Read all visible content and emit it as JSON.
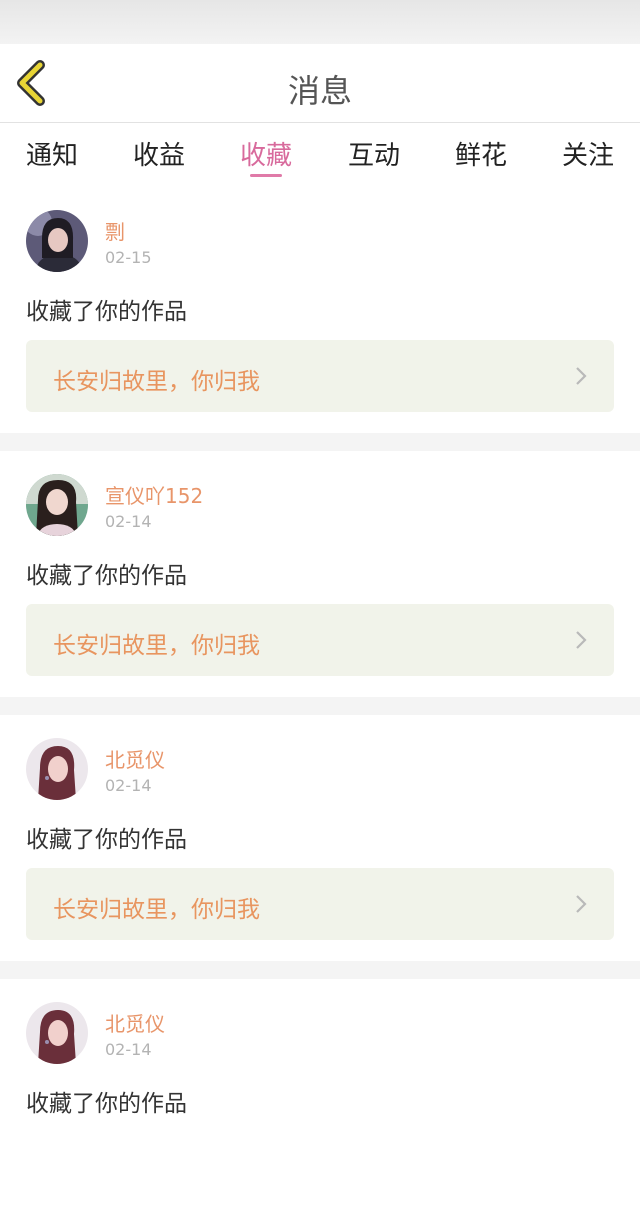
{
  "header": {
    "title": "消息"
  },
  "tabs": [
    {
      "label": "通知"
    },
    {
      "label": "收益"
    },
    {
      "label": "收藏"
    },
    {
      "label": "互动"
    },
    {
      "label": "鲜花"
    },
    {
      "label": "关注"
    }
  ],
  "active_tab": "收藏",
  "colors": {
    "accent": "#d86a9c",
    "name": "#e8956a",
    "work_title": "#e8955f",
    "work_box_bg": "#f1f3ea",
    "back_icon": "#e8d535"
  },
  "icons": {
    "back": "back-arrow-icon",
    "chevron": "chevron-right-icon"
  },
  "messages": [
    {
      "user": "剽",
      "date": "02-15",
      "action": "收藏了你的作品",
      "work_title": "长安归故里，你归我"
    },
    {
      "user": "宣仪吖152",
      "date": "02-14",
      "action": "收藏了你的作品",
      "work_title": "长安归故里，你归我"
    },
    {
      "user": "北觅仪",
      "date": "02-14",
      "action": "收藏了你的作品",
      "work_title": "长安归故里，你归我"
    },
    {
      "user": "北觅仪",
      "date": "02-14",
      "action": "收藏了你的作品",
      "work_title": ""
    }
  ]
}
